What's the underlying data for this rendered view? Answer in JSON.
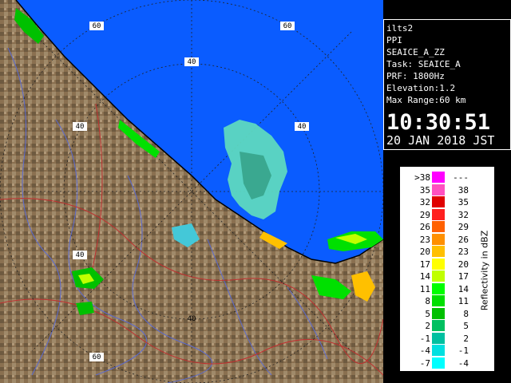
{
  "info": {
    "lines": [
      "ilts2",
      "PPI",
      "SEAICE_A_ZZ",
      "Task: SEAICE_A",
      "PRF: 1800Hz",
      "Elevation:1.2",
      "Max Range:60 km"
    ],
    "time": "10:30:51",
    "date": "20 JAN 2018 JST"
  },
  "range_rings": [
    "60",
    "40",
    "40",
    "40",
    "40",
    "60",
    "60"
  ],
  "legend": {
    "unit": "Reflectivity in dBZ",
    "rows": [
      {
        "min": ">38",
        "max": "---",
        "color": "#ff00ff"
      },
      {
        "min": "35",
        "max": "38",
        "color": "#ff50c0"
      },
      {
        "min": "32",
        "max": "35",
        "color": "#e00000"
      },
      {
        "min": "29",
        "max": "32",
        "color": "#ff2020"
      },
      {
        "min": "26",
        "max": "29",
        "color": "#ff6000"
      },
      {
        "min": "23",
        "max": "26",
        "color": "#ff9000"
      },
      {
        "min": "20",
        "max": "23",
        "color": "#ffc000"
      },
      {
        "min": "17",
        "max": "20",
        "color": "#ffff00"
      },
      {
        "min": "14",
        "max": "17",
        "color": "#c0ff00"
      },
      {
        "min": "11",
        "max": "14",
        "color": "#00ff00"
      },
      {
        "min": "8",
        "max": "11",
        "color": "#00e000"
      },
      {
        "min": "5",
        "max": "8",
        "color": "#00c000"
      },
      {
        "min": "2",
        "max": "5",
        "color": "#00c060"
      },
      {
        "min": "-1",
        "max": "2",
        "color": "#00c0a0"
      },
      {
        "min": "-4",
        "max": "-1",
        "color": "#00e0e0"
      },
      {
        "min": "-7",
        "max": "-4",
        "color": "#00ffff"
      }
    ]
  },
  "colors": {
    "sea": "#0a5cff",
    "land": "#8a7050",
    "border": "#ffffff"
  }
}
